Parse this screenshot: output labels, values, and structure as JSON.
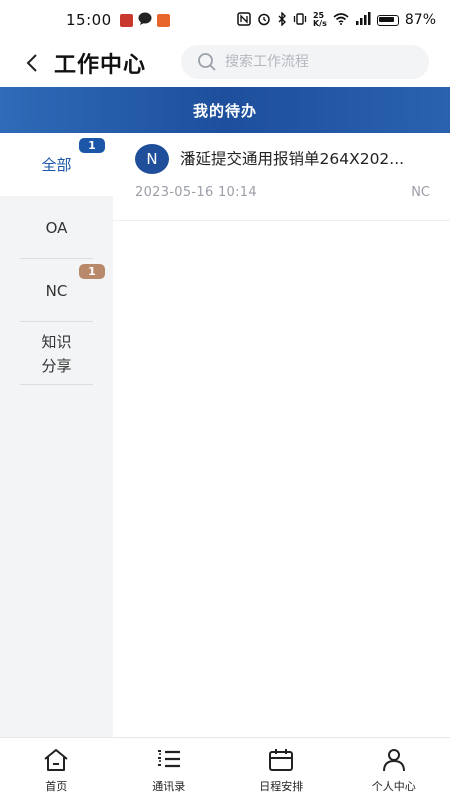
{
  "status_bar": {
    "time": "15:00",
    "speed_top": "25",
    "speed_bottom": "K/s",
    "battery": "87%"
  },
  "header": {
    "title": "工作中心",
    "search_placeholder": "搜索工作流程"
  },
  "banner": {
    "title": "我的待办"
  },
  "sidebar": {
    "items": [
      {
        "label": "全部",
        "badge": "1",
        "active": true
      },
      {
        "label": "OA"
      },
      {
        "label": "NC",
        "badge": "1"
      },
      {
        "label_line1": "知识",
        "label_line2": "分享"
      }
    ]
  },
  "tasks": [
    {
      "avatar": "N",
      "title": "潘延提交通用报销单264X202...",
      "time": "2023-05-16 10:14",
      "source": "NC"
    }
  ],
  "bottom_nav": {
    "items": [
      {
        "label": "首页",
        "icon": "home-icon"
      },
      {
        "label": "通讯录",
        "icon": "contacts-list-icon"
      },
      {
        "label": "日程安排",
        "icon": "calendar-icon"
      },
      {
        "label": "个人中心",
        "icon": "person-icon"
      }
    ]
  },
  "colors": {
    "primary": "#1b56a8",
    "banner_start": "#2f6bb8",
    "banner_end": "#1d4f9c",
    "badge_brown": "#b8896a",
    "sidebar_bg": "#f3f4f6"
  }
}
